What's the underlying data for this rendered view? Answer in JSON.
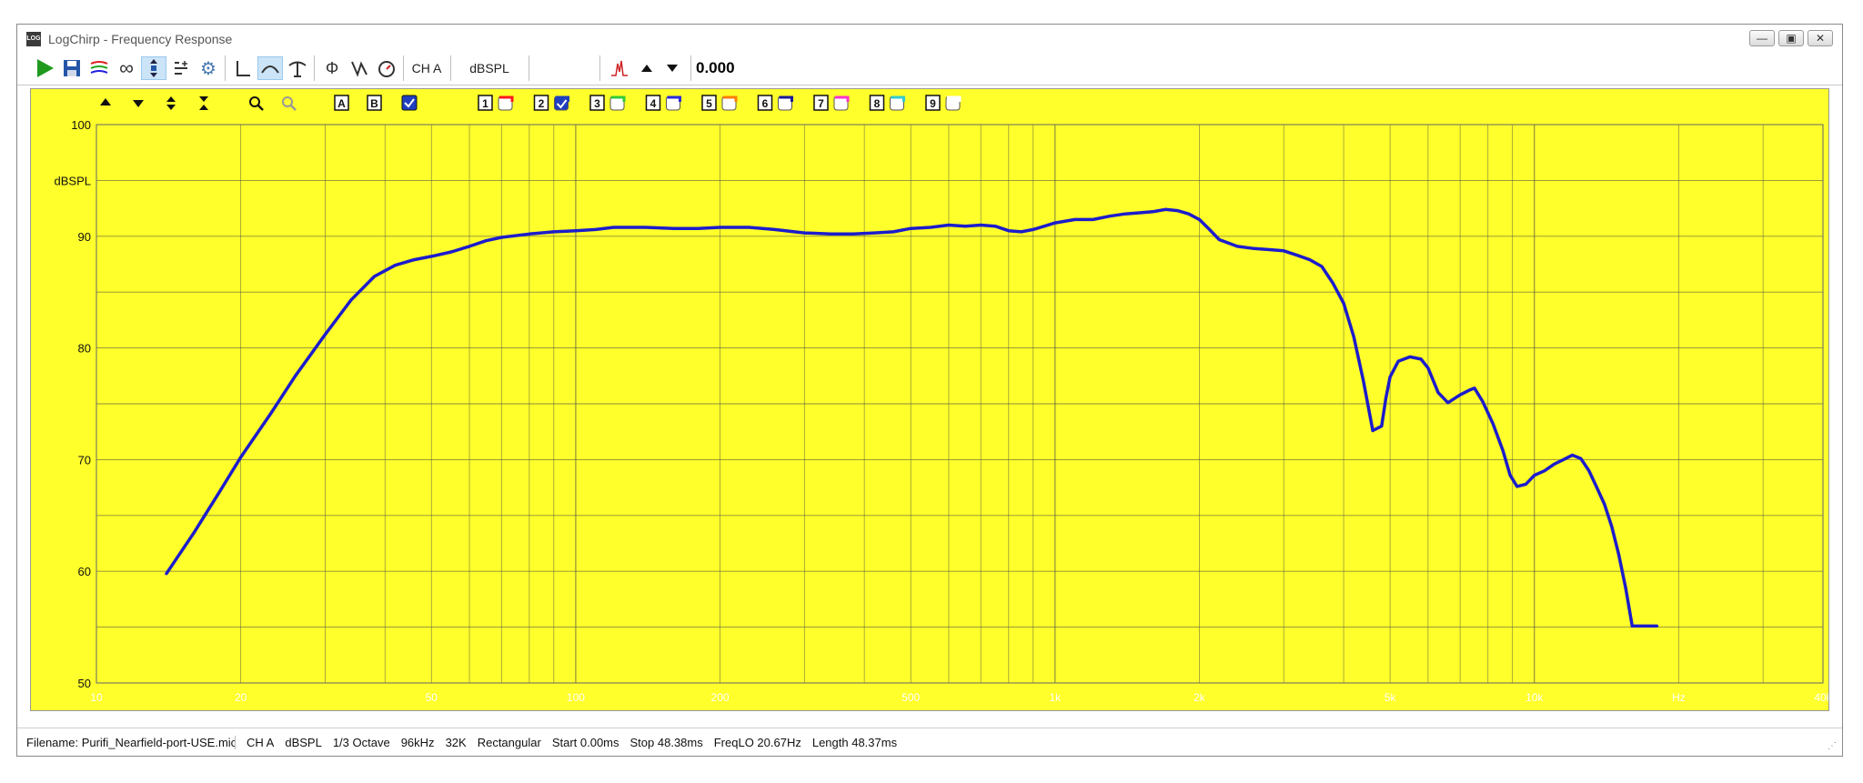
{
  "window": {
    "title": "LogChirp - Frequency Response",
    "app_icon_text": "LOG"
  },
  "toolbar": {
    "channel": "CH A",
    "unit": "dBSPL",
    "value": "0.000"
  },
  "plot": {
    "overlay_buttons": [
      "A",
      "B"
    ],
    "trace_numbers": [
      "1",
      "2",
      "3",
      "4",
      "5",
      "6",
      "7",
      "8",
      "9"
    ],
    "trace_colors": [
      "#ff1a1a",
      "#1f3fbf",
      "#33cc33",
      "#2a2ad9",
      "#ff8000",
      "#1a1a99",
      "#ff33cc",
      "#33cccc",
      "#ffffff"
    ],
    "trace_checked": [
      false,
      true,
      false,
      false,
      false,
      false,
      false,
      false,
      false
    ],
    "curve_color": "#1c1ccc",
    "background_color": "#ffff2b"
  },
  "status": {
    "filename": "Filename: Purifi_Nearfield-port-USE.mic",
    "channel": "CH A",
    "unit": "dBSPL",
    "smoothing": "1/3 Octave",
    "sample_rate": "96kHz",
    "fft": "32K",
    "window": "Rectangular",
    "start": "Start 0.00ms",
    "stop": "Stop 48.38ms",
    "freqlo": "FreqLO 20.67Hz",
    "length": "Length 48.37ms"
  },
  "chart_data": {
    "type": "line",
    "title": "",
    "xlabel": "Hz",
    "ylabel": "dBSPL",
    "xscale": "log",
    "xlim": [
      10,
      40000
    ],
    "ylim": [
      50,
      100
    ],
    "grid": true,
    "yticks": [
      50,
      60,
      70,
      80,
      90,
      100
    ],
    "ytick_labels": [
      "50",
      "60",
      "70",
      "80",
      "90",
      "100"
    ],
    "xticks": [
      10,
      20,
      50,
      100,
      200,
      500,
      1000,
      2000,
      5000,
      10000,
      20000,
      40000
    ],
    "xtick_labels": [
      "10",
      "20",
      "50",
      "100",
      "200",
      "500",
      "1k",
      "2k",
      "5k",
      "10k",
      "Hz",
      "40k"
    ],
    "series": [
      {
        "name": "",
        "x": [
          14,
          16,
          18,
          20,
          23,
          26,
          30,
          34,
          38,
          42,
          46,
          50,
          55,
          60,
          65,
          70,
          80,
          90,
          100,
          110,
          120,
          140,
          160,
          180,
          200,
          230,
          260,
          300,
          340,
          380,
          420,
          460,
          500,
          550,
          600,
          650,
          700,
          750,
          800,
          850,
          900,
          950,
          1000,
          1100,
          1200,
          1300,
          1400,
          1500,
          1600,
          1700,
          1800,
          1900,
          2000,
          2100,
          2200,
          2400,
          2600,
          2800,
          3000,
          3200,
          3400,
          3600,
          3800,
          4000,
          4200,
          4400,
          4600,
          4800,
          4900,
          5000,
          5200,
          5500,
          5800,
          6000,
          6300,
          6600,
          7000,
          7300,
          7500,
          7800,
          8200,
          8600,
          8900,
          9200,
          9600,
          10000,
          10500,
          11000,
          11500,
          12000,
          12500,
          13000,
          13500,
          14000,
          14500,
          15000,
          15500,
          16000,
          16500,
          17000,
          17500,
          18000
        ],
        "y": [
          59.8,
          63.5,
          67,
          70.2,
          74,
          77.5,
          81.2,
          84.3,
          86.4,
          87.4,
          87.9,
          88.2,
          88.6,
          89.1,
          89.6,
          89.9,
          90.2,
          90.4,
          90.5,
          90.6,
          90.8,
          90.8,
          90.7,
          90.7,
          90.8,
          90.8,
          90.6,
          90.3,
          90.2,
          90.2,
          90.3,
          90.4,
          90.7,
          90.8,
          91.0,
          90.9,
          91.0,
          90.9,
          90.5,
          90.4,
          90.6,
          90.9,
          91.2,
          91.5,
          91.5,
          91.8,
          92.0,
          92.1,
          92.2,
          92.4,
          92.3,
          92.0,
          91.5,
          90.6,
          89.7,
          89.1,
          88.9,
          88.8,
          88.7,
          88.3,
          87.9,
          87.3,
          85.8,
          84.0,
          81.0,
          77.0,
          72.6,
          73.0,
          75.5,
          77.4,
          78.8,
          79.2,
          79.0,
          78.2,
          76.0,
          75.1,
          75.8,
          76.2,
          76.4,
          75.2,
          73.2,
          70.8,
          68.6,
          67.6,
          67.8,
          68.6,
          69.0,
          69.6,
          70.0,
          70.4,
          70.1,
          69.0,
          67.5,
          66.0,
          64.0,
          61.5,
          58.5,
          55.1,
          55.1,
          55.1,
          55.1,
          55.1
        ]
      }
    ]
  }
}
